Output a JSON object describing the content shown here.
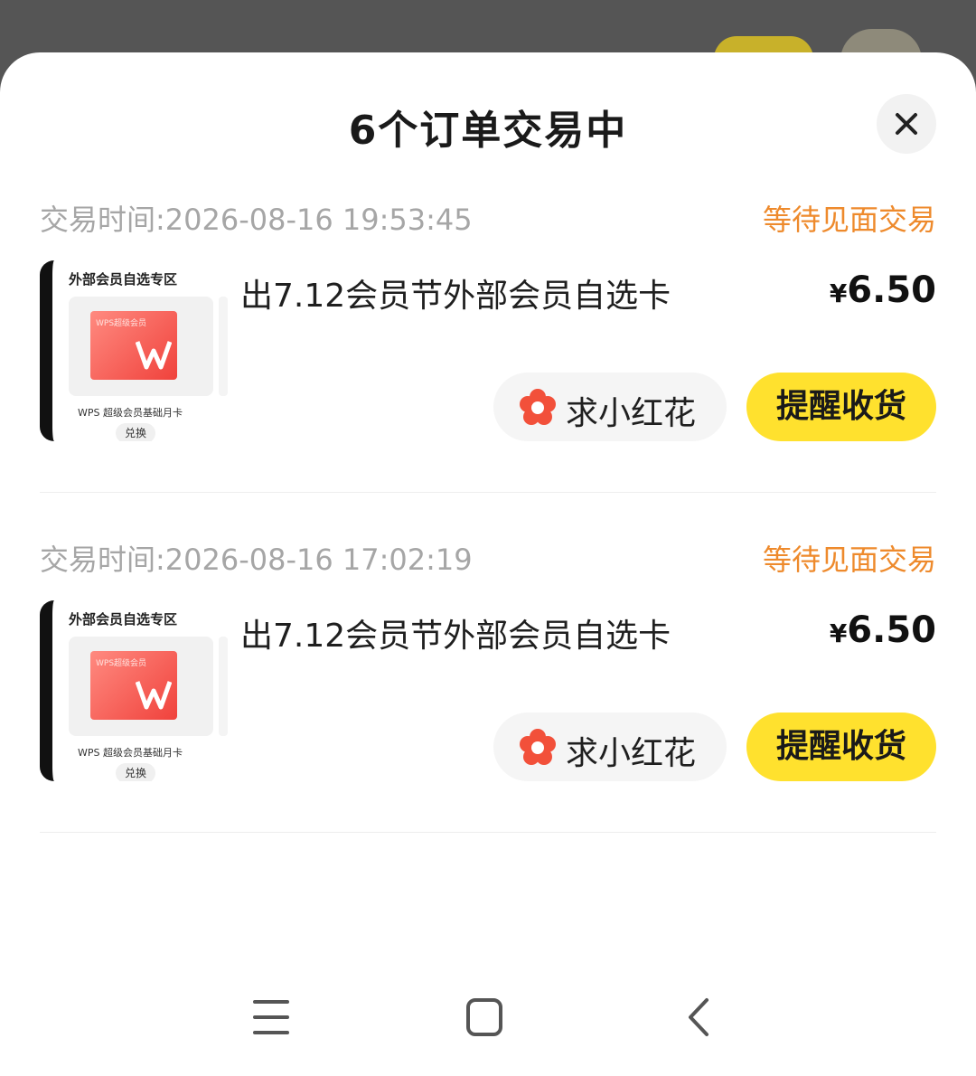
{
  "sheet": {
    "title": "6个订单交易中",
    "close_icon": "close-icon"
  },
  "orders": [
    {
      "time": "交易时间:2026-08-16 19:53:45",
      "status": "等待见面交易",
      "thumbnail": {
        "zone": "外部会员自选专区",
        "card_label": "WPS超级会员",
        "desc": "WPS 超级会员基础月卡",
        "exchange": "兑换"
      },
      "title": "出7.12会员节外部会员自选卡",
      "price_symbol": "¥",
      "price": "6.50",
      "flower_button": "求小红花",
      "remind_button": "提醒收货"
    },
    {
      "time": "交易时间:2026-08-16 17:02:19",
      "status": "等待见面交易",
      "thumbnail": {
        "zone": "外部会员自选专区",
        "card_label": "WPS超级会员",
        "desc": "WPS 超级会员基础月卡",
        "exchange": "兑换"
      },
      "title": "出7.12会员节外部会员自选卡",
      "price_symbol": "¥",
      "price": "6.50",
      "flower_button": "求小红花",
      "remind_button": "提醒收货"
    }
  ],
  "colors": {
    "status": "#ee8a2c",
    "remind_button": "#ffe12e",
    "flower": "#f2503a"
  },
  "nav": {
    "menu_icon": "menu-icon",
    "home_icon": "home-icon",
    "back_icon": "back-icon"
  }
}
